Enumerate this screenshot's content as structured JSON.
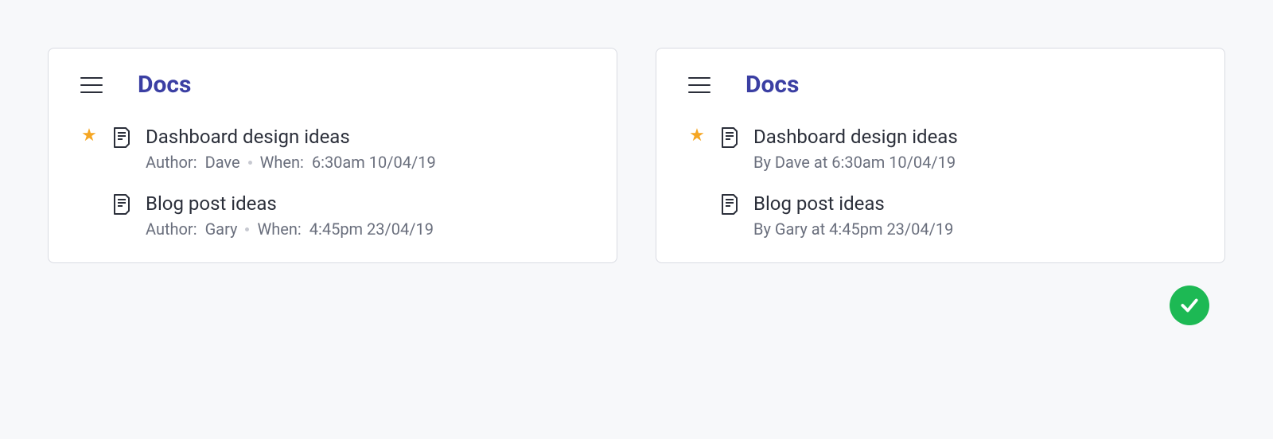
{
  "left": {
    "title": "Docs",
    "items": [
      {
        "starred": true,
        "title": "Dashboard design ideas",
        "author_label": "Author:",
        "author": "Dave",
        "when_label": "When:",
        "when": "6:30am 10/04/19"
      },
      {
        "starred": false,
        "title": "Blog post ideas",
        "author_label": "Author:",
        "author": "Gary",
        "when_label": "When:",
        "when": "4:45pm 23/04/19"
      }
    ]
  },
  "right": {
    "title": "Docs",
    "items": [
      {
        "starred": true,
        "title": "Dashboard design ideas",
        "meta": "By Dave at 6:30am 10/04/19"
      },
      {
        "starred": false,
        "title": "Blog post ideas",
        "meta": "By Gary at 4:45pm 23/04/19"
      }
    ]
  }
}
